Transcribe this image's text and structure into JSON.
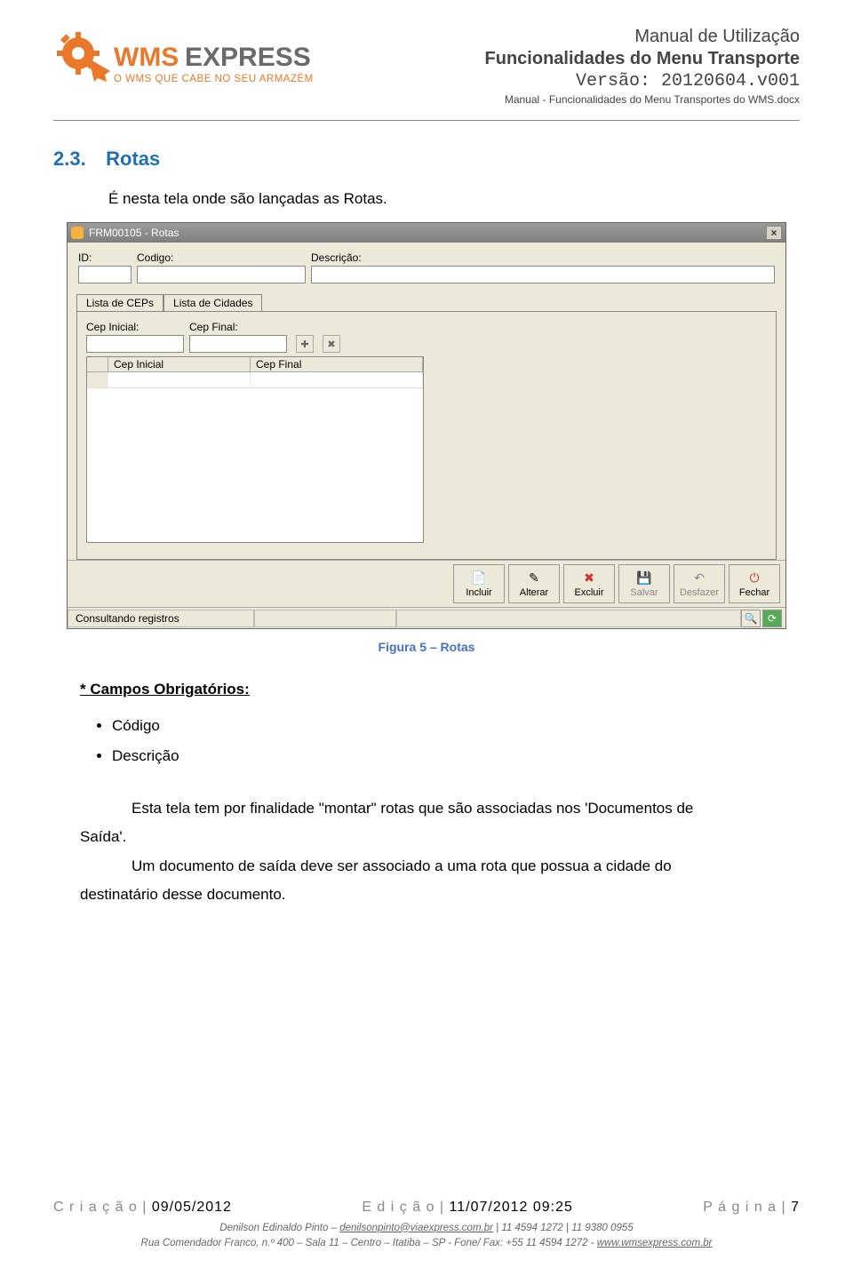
{
  "header": {
    "logo_text_wms": "WMS",
    "logo_text_express": "EXPRESS",
    "logo_tagline": "O WMS QUE CABE NO SEU ARMAZÉM",
    "title1": "Manual de Utilização",
    "title2": "Funcionalidades do Menu Transporte",
    "version": "Versão: 20120604.v001",
    "docname": "Manual - Funcionalidades do Menu Transportes do WMS.docx"
  },
  "section": {
    "number": "2.3.",
    "title": "Rotas",
    "intro": "É nesta tela onde são lançadas as Rotas."
  },
  "screenshot": {
    "window_title": "FRM00105 - Rotas",
    "fields": {
      "id_label": "ID:",
      "codigo_label": "Codigo:",
      "descricao_label": "Descrição:"
    },
    "tabs": {
      "tab1": "Lista de CEPs",
      "tab2": "Lista de Cidades"
    },
    "cep": {
      "inicial_label": "Cep Inicial:",
      "final_label": "Cep Final:",
      "col_inicial": "Cep Inicial",
      "col_final": "Cep Final"
    },
    "buttons": {
      "incluir": "Incluir",
      "alterar": "Alterar",
      "excluir": "Excluir",
      "salvar": "Salvar",
      "desfazer": "Desfazer",
      "fechar": "Fechar"
    },
    "status": "Consultando registros"
  },
  "caption": "Figura 5 – Rotas",
  "campos": {
    "heading": "* Campos Obrigatórios:",
    "item1": "Código",
    "item2": "Descrição"
  },
  "body": {
    "p1a": "Esta tela tem por finalidade \"montar\" rotas que são associadas nos 'Documentos de",
    "p1b": "Saída'.",
    "p2a": "Um documento de saída deve ser associado a uma rota que possua a cidade do",
    "p2b": "destinatário desse documento."
  },
  "footer": {
    "criacao_label": "C r i a ç ã o |",
    "criacao_value": "09/05/2012",
    "edicao_label": "E d i ç ã o |",
    "edicao_value": "11/07/2012 09:25",
    "pagina_label": "P á g i n a |",
    "pagina_value": "7",
    "line2_name": "Denilson Edinaldo Pinto – ",
    "line2_email": "denilsonpinto@viaexpress.com.br",
    "line2_phones": " | 11 4594 1272 | 11 9380 0955",
    "line3_addr": "Rua Comendador Franco, n.º 400 – Sala 11 – Centro – Itatiba – SP - Fone/ Fax: +55 11 4594 1272 - ",
    "line3_url": "www.wmsexpress.com.br"
  }
}
